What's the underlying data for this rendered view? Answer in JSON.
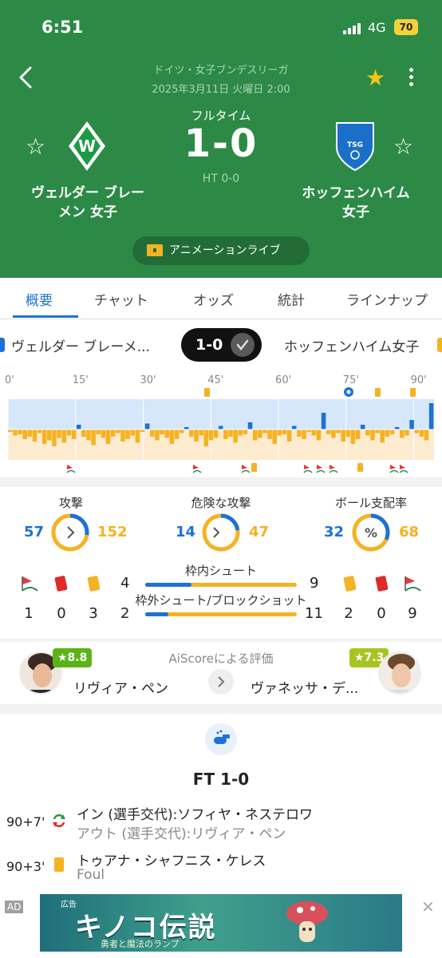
{
  "status_bar": {
    "time": "6:51",
    "network": "4G",
    "battery": "70"
  },
  "match": {
    "league": "ドイツ・女子ブンデスリーガ",
    "datetime": "2025年3月11日 火曜日 2:00",
    "status": "フルタイム",
    "score": "1-0",
    "halftime": "HT 0-0",
    "home_team": "ヴェルダー ブレーメン 女子",
    "away_team": "ホッフェンハイム 女子",
    "home_team_line1": "ヴェルダー ブレー",
    "home_team_line2": "メン 女子",
    "away_team_line1": "ホッフェンハイム",
    "away_team_line2": "女子",
    "animation_live": "アニメーションライブ"
  },
  "tabs": [
    "概要",
    "チャット",
    "オッズ",
    "統計",
    "ラインナップ"
  ],
  "score_strip": {
    "home": "ヴェルダー ブレーメ...",
    "score": "1-0",
    "away": "ホッフェンハイム女子"
  },
  "timeline": {
    "ticks": [
      "0'",
      "15'",
      "30'",
      "45'",
      "60'",
      "75'",
      "90'"
    ],
    "momentum": [
      -2,
      -5,
      -4,
      -8,
      -6,
      -10,
      -3,
      -12,
      -9,
      -14,
      -7,
      -11,
      -5,
      -8,
      4,
      -6,
      -9,
      -13,
      -4,
      -7,
      -12,
      -6,
      -3,
      -10,
      -8,
      -5,
      -11,
      -2,
      5,
      -6,
      -9,
      -4,
      -7,
      -12,
      -8,
      -3,
      2,
      -6,
      -10,
      -5,
      -14,
      -9,
      -7,
      3,
      -8,
      -6,
      -11,
      -5,
      -4,
      6,
      -9,
      -7,
      -3,
      -8,
      -12,
      -5,
      -4,
      -10,
      3,
      -6,
      -8,
      -2,
      -5,
      -9,
      14,
      -4,
      -7,
      -3,
      -10,
      -6,
      -12,
      -8,
      4,
      -5,
      -9,
      -3,
      -11,
      -6,
      -4,
      2,
      -7,
      -5,
      8,
      -3,
      -6,
      -9,
      22
    ]
  },
  "stats": {
    "attack": {
      "label": "攻撃",
      "home": 57,
      "away": 152
    },
    "dangerous_attack": {
      "label": "危険な攻撃",
      "home": 14,
      "away": 47
    },
    "possession": {
      "label": "ボール支配率",
      "home": 32,
      "away": 68
    },
    "shots_on_target": {
      "label": "枠内シュート",
      "home": 4,
      "away": 9
    },
    "shots_off_blocked": {
      "label": "枠外シュート/ブロックショット",
      "home": 2,
      "away": 11
    },
    "home_counts": {
      "corners": 1,
      "red_cards": 0,
      "yellow_cards": 3
    },
    "away_counts": {
      "yellow_cards": 2,
      "red_cards": 0,
      "corners": 9
    }
  },
  "rating": {
    "title": "AiScoreによる評価",
    "home_player": "リヴィア・ペン",
    "home_score": "★8.8",
    "away_player": "ヴァネッサ・デ...",
    "away_score": "★7.3"
  },
  "events": {
    "final": "FT 1-0",
    "items": [
      {
        "minute": "90+7'",
        "main": "イン (選手交代):ソフィヤ・ネステロワ",
        "sub": "アウト (選手交代):リヴィア・ペン",
        "icon": "substitution-icon"
      },
      {
        "minute": "90+3'",
        "main": "トゥアナ・シャフニス・ケレス",
        "sub": "Foul",
        "icon": "yellow-card-icon"
      }
    ]
  },
  "ad": {
    "tag": "AD",
    "label": "広告",
    "title": "キノコ伝説",
    "subtitle": "勇者と魔法のランプ"
  },
  "colors": {
    "header_green": "#2c8a46",
    "home_blue": "#1a73d6",
    "away_orange": "#f5b223"
  }
}
